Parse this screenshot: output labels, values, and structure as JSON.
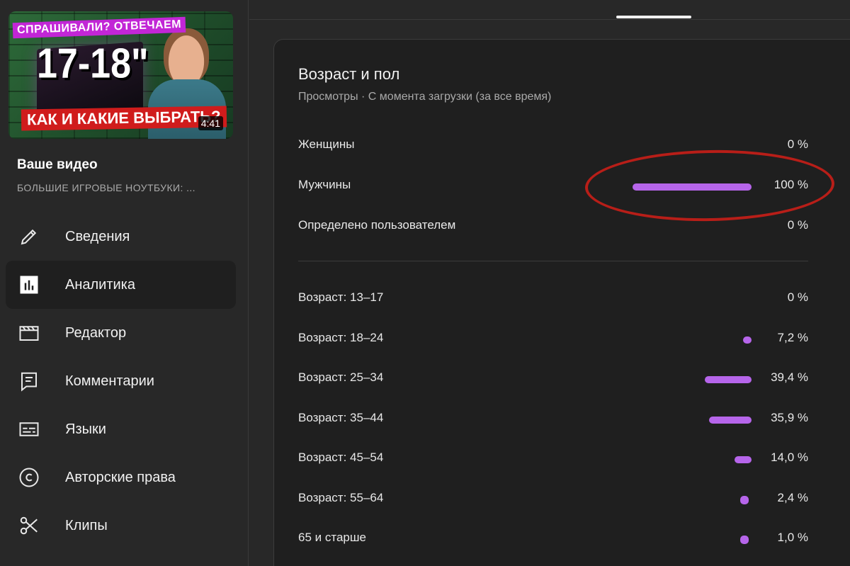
{
  "sidebar": {
    "thumbnail": {
      "tag_top": "СПРАШИВАЛИ? ОТВЕЧАЕМ",
      "big_text": "17-18\"",
      "tag_bottom": "КАК И КАКИЕ ВЫБРАТЬ?",
      "duration": "4:41"
    },
    "video_title": "Ваше видео",
    "video_subtitle": "БОЛЬШИЕ ИГРОВЫЕ НОУТБУКИ: ...",
    "nav": [
      {
        "label": "Сведения",
        "icon": "pencil-icon",
        "active": false
      },
      {
        "label": "Аналитика",
        "icon": "analytics-icon",
        "active": true
      },
      {
        "label": "Редактор",
        "icon": "clapperboard-icon",
        "active": false
      },
      {
        "label": "Комментарии",
        "icon": "comment-icon",
        "active": false
      },
      {
        "label": "Языки",
        "icon": "subtitles-icon",
        "active": false
      },
      {
        "label": "Авторские права",
        "icon": "copyright-icon",
        "active": false
      },
      {
        "label": "Клипы",
        "icon": "scissors-icon",
        "active": false
      }
    ]
  },
  "card": {
    "title": "Возраст и пол",
    "subtitle": "Просмотры · С момента загрузки (за все время)",
    "gender": [
      {
        "label": "Женщины",
        "value": "0 %",
        "percent": 0
      },
      {
        "label": "Мужчины",
        "value": "100 %",
        "percent": 100
      },
      {
        "label": "Определено пользователем",
        "value": "0 %",
        "percent": 0
      }
    ],
    "age": [
      {
        "label": "Возраст: 13–17",
        "value": "0 %",
        "percent": 0
      },
      {
        "label": "Возраст: 18–24",
        "value": "7,2 %",
        "percent": 7.2
      },
      {
        "label": "Возраст: 25–34",
        "value": "39,4 %",
        "percent": 39.4
      },
      {
        "label": "Возраст: 35–44",
        "value": "35,9 %",
        "percent": 35.9
      },
      {
        "label": "Возраст: 45–54",
        "value": "14,0 %",
        "percent": 14.0
      },
      {
        "label": "Возраст: 55–64",
        "value": "2,4 %",
        "percent": 2.4
      },
      {
        "label": "65 и старше",
        "value": "1,0 %",
        "percent": 1.0
      }
    ]
  },
  "colors": {
    "bar": "#b665ea",
    "highlight": "#b81e18",
    "background": "#282828",
    "card": "#1f1f1f"
  }
}
